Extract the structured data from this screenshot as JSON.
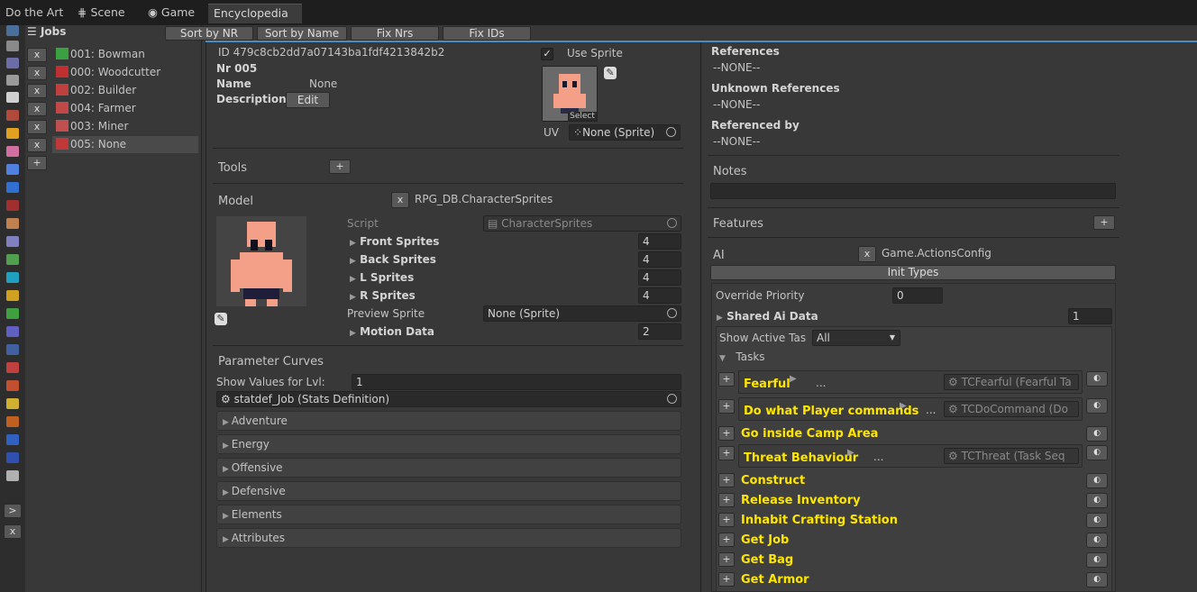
{
  "tabs": [
    "Do the Art",
    "Scene",
    "Game",
    "Encyclopedia *"
  ],
  "toolbar": {
    "sort_nr": "Sort by NR",
    "sort_name": "Sort by Name",
    "fix_nrs": "Fix Nrs",
    "fix_ids": "Fix IDs"
  },
  "jobs_header": "Jobs",
  "jobs": [
    "001: Bowman",
    "000: Woodcutter",
    "002: Builder",
    "004: Farmer",
    "003: Miner",
    "005: None"
  ],
  "small": {
    "x": "x",
    "plus": "+",
    "gt": ">",
    "pencil": "✎",
    "select": "Select",
    "ellipsis": "..."
  },
  "detail": {
    "id": "ID 479c8cb2dd7a07143ba1fdf4213842b2",
    "nr": "Nr 005",
    "name_label": "Name",
    "name_value": "None",
    "desc_label": "Description",
    "edit": "Edit",
    "use_sprite": "Use Sprite",
    "uv": "UV",
    "uv_value": "None (Sprite)",
    "tools": "Tools",
    "model": "Model",
    "model_type": "RPG_DB.CharacterSprites",
    "script_label": "Script",
    "script_value": "CharacterSprites",
    "front": "Front Sprites",
    "front_v": "4",
    "back": "Back Sprites",
    "back_v": "4",
    "l": "L Sprites",
    "l_v": "4",
    "r": "R Sprites",
    "r_v": "4",
    "preview": "Preview Sprite",
    "preview_v": "None (Sprite)",
    "motion": "Motion Data",
    "motion_v": "2",
    "curves": "Parameter Curves",
    "show_lvl": "Show Values for Lvl:",
    "show_lvl_v": "1",
    "statdef": "statdef_Job (Stats Definition)",
    "foldouts": [
      "Adventure",
      "Energy",
      "Offensive",
      "Defensive",
      "Elements",
      "Attributes"
    ]
  },
  "right": {
    "refs": "References",
    "refs_v": "--NONE--",
    "unknown": "Unknown References",
    "unknown_v": "--NONE--",
    "refby": "Referenced by",
    "refby_v": "--NONE--",
    "notes": "Notes",
    "features": "Features",
    "ai": "AI",
    "ai_type": "Game.ActionsConfig",
    "init": "Init Types",
    "override": "Override Priority",
    "override_v": "0",
    "shared": "Shared Ai Data",
    "shared_v": "1",
    "show_active": "Show Active Tas",
    "show_active_v": "All",
    "tasks": "Tasks",
    "task_items": [
      "Fearful",
      "Do what Player commands",
      "Go inside Camp Area",
      "Threat Behaviour",
      "Construct",
      "Release Inventory",
      "Inhabit Crafting Station",
      "Get Job",
      "Get Bag",
      "Get Armor"
    ],
    "refs_fields": [
      "TCFearful (Fearful Ta",
      "TCDoCommand (Do",
      "TCThreat (Task Seq"
    ]
  },
  "colors": {
    "task_yellow": "#ffe600",
    "accent_blue": "#4a8cc0"
  }
}
